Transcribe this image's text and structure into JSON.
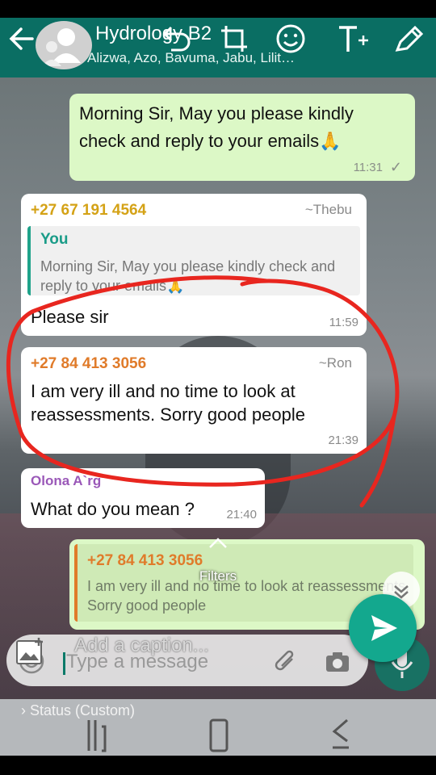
{
  "header": {
    "title": "Hydrology B2",
    "members": "Alizwa, Azo, Bavuma, Jabu, Lilit…",
    "color": "#0a6e63"
  },
  "messages": [
    {
      "direction": "outgoing",
      "text": "Morning Sir, May you please kindly check  and reply to your emails🙏",
      "time": "11:31",
      "tick": "✓"
    },
    {
      "direction": "incoming",
      "sender": "+27 67 191 4564",
      "sender_color": "#d4a216",
      "alias": "~Thebu",
      "quote_author": "You",
      "quote_text": "Morning Sir, May you please kindly check and reply to your emails🙏",
      "text": "Please sir",
      "time": "11:59"
    },
    {
      "direction": "incoming",
      "sender": "+27 84 413 3056",
      "sender_color": "#e07b2a",
      "alias": "~Ron",
      "text": "I am very ill and no time to look at reassessments.  Sorry good people",
      "time": "21:39"
    },
    {
      "direction": "incoming",
      "sender": "Olona A`rg",
      "sender_color": "#9a58b8",
      "text": "What do you mean ?",
      "time": "21:40"
    },
    {
      "direction": "outgoing",
      "quote_author": "+27 84 413 3056",
      "quote_text": "I am very ill and no time to look at reassessments.  Sorry good people"
    }
  ],
  "composer": {
    "filters_label": "Filters",
    "caption_placeholder": "Add a caption...",
    "message_placeholder": "Type a message"
  },
  "status_bar": {
    "label": "Status (Custom)"
  },
  "icons": [
    "back-arrow-icon",
    "group-avatar-icon",
    "undo-icon",
    "crop-rotate-icon",
    "emoji-icon",
    "text-tool-icon",
    "pencil-icon",
    "gallery-icon",
    "attach-icon",
    "camera-icon",
    "send-icon",
    "mic-icon",
    "chevron-down-icon",
    "chevron-up-icon"
  ],
  "colors": {
    "accent": "#0a6e63",
    "send": "#13a88e",
    "outgoing_bubble": "#dcf8c6",
    "annotation": "#e8261f"
  }
}
